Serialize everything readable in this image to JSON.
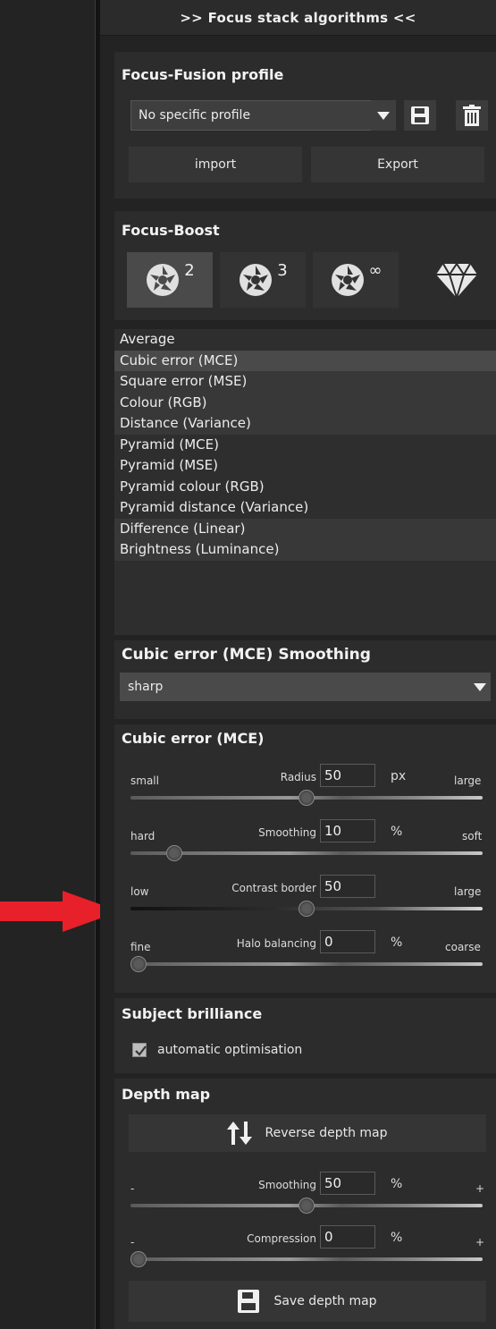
{
  "header": {
    "title": ">> Focus stack algorithms <<"
  },
  "profile": {
    "title": "Focus-Fusion profile",
    "selected": "No specific profile",
    "import_label": "import",
    "export_label": "Export"
  },
  "boost": {
    "title": "Focus-Boost",
    "items": [
      {
        "icon": "aperture-icon",
        "sup": "2"
      },
      {
        "icon": "aperture-icon",
        "sup": "3"
      },
      {
        "icon": "aperture-icon",
        "sup": "∞"
      },
      {
        "icon": "diamond-icon",
        "sup": ""
      }
    ]
  },
  "algorithms": {
    "items": [
      "Average",
      "Cubic error (MCE)",
      "Square error (MSE)",
      "Colour (RGB)",
      "Distance (Variance)",
      "Pyramid (MCE)",
      "Pyramid (MSE)",
      "Pyramid colour (RGB)",
      "Pyramid distance (Variance)",
      "Difference (Linear)",
      "Brightness (Luminance)"
    ],
    "selected": "Cubic error (MCE)"
  },
  "smoothing_select": {
    "title": "Cubic error (MCE) Smoothing",
    "value": "sharp"
  },
  "mce": {
    "title": "Cubic error (MCE)",
    "sliders": [
      {
        "left": "small",
        "label": "Radius",
        "value": "50",
        "unit": "px",
        "right": "large",
        "level": 0.5
      },
      {
        "left": "hard",
        "label": "Smoothing",
        "value": "10",
        "unit": "%",
        "right": "soft",
        "level": 0.1
      },
      {
        "left": "low",
        "label": "Contrast border",
        "value": "50",
        "unit": "",
        "right": "large",
        "level": 0.5
      },
      {
        "left": "fine",
        "label": "Halo balancing",
        "value": "0",
        "unit": "%",
        "right": "coarse",
        "level": 0
      }
    ]
  },
  "brilliance": {
    "title": "Subject brilliance",
    "checkbox_label": "automatic optimisation",
    "checked": true
  },
  "depth": {
    "title": "Depth map",
    "reverse_label": "Reverse depth map",
    "sliders": [
      {
        "left": "-",
        "label": "Smoothing",
        "value": "50",
        "unit": "%",
        "right": "+",
        "level": 0.5
      },
      {
        "left": "-",
        "label": "Compression",
        "value": "0",
        "unit": "%",
        "right": "+",
        "level": 0
      }
    ],
    "save_label": "Save depth map"
  },
  "colors": {
    "accent_arrow": "#e8202a"
  }
}
